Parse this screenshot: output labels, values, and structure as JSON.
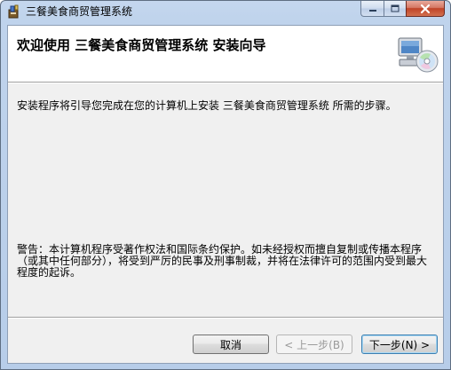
{
  "window": {
    "title": "三餐美食商贸管理系统",
    "icon": "installer-app-icon"
  },
  "banner": {
    "title": "欢迎使用 三餐美食商贸管理系统 安装向导",
    "icon": "computer-cd-icon"
  },
  "content": {
    "intro": "安装程序将引导您完成在您的计算机上安装 三餐美食商贸管理系统 所需的步骤。",
    "warning": "警告：本计算机程序受著作权法和国际条约保护。如未经授权而擅自复制或传播本程序（或其中任何部分），将受到严厉的民事及刑事制裁，并将在法律许可的范围内受到最大程度的起诉。"
  },
  "buttons": {
    "cancel": "取消",
    "prev": "< 上一步(B)",
    "next": "下一步(N) >"
  },
  "colors": {
    "close_button": "#c04327",
    "window_frame": "#bfd3ec",
    "client_bg": "#f0f0f0"
  }
}
